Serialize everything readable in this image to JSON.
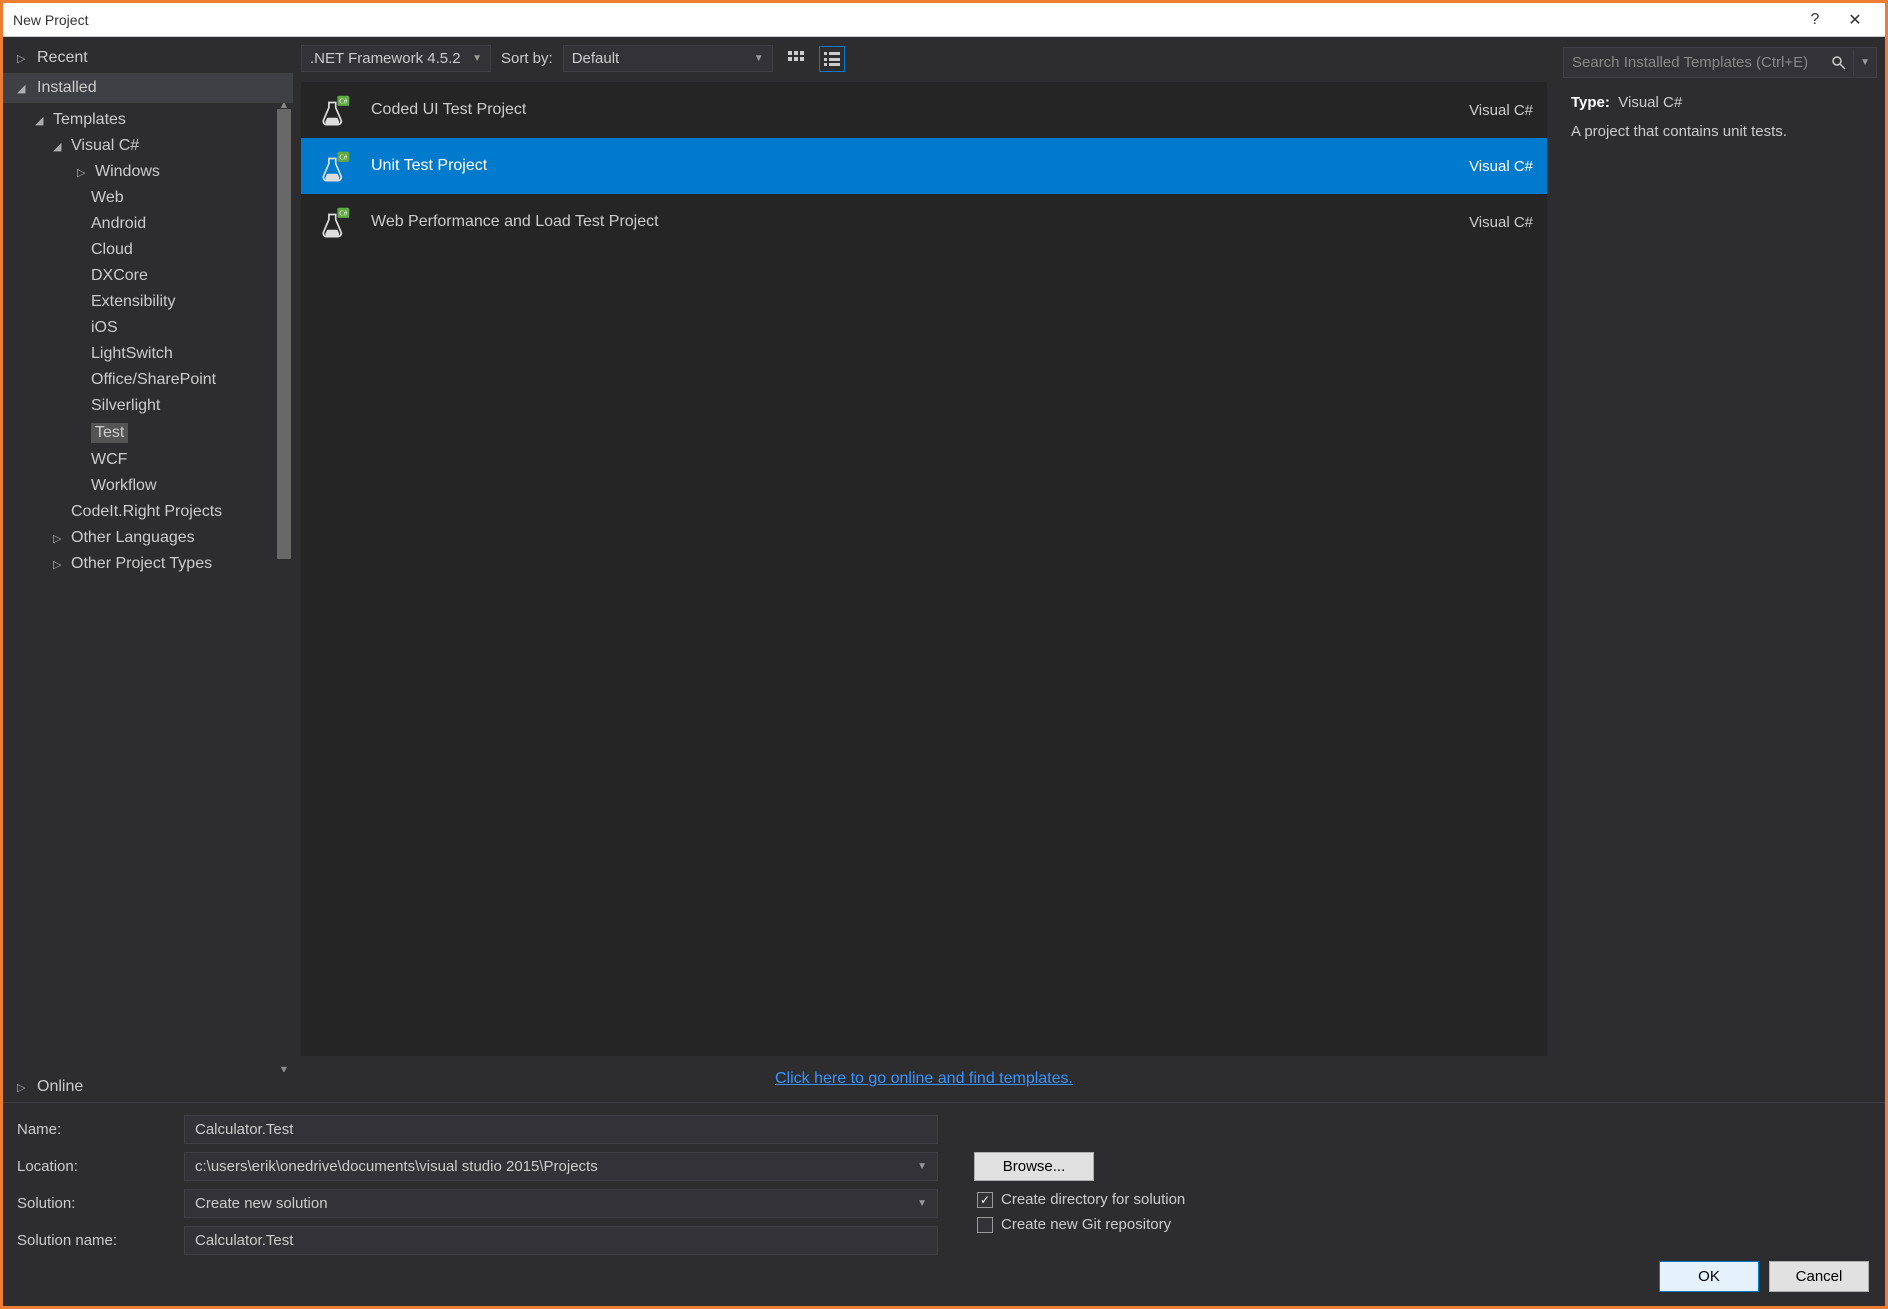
{
  "window": {
    "title": "New Project"
  },
  "sidebar": {
    "recent": "Recent",
    "installed": "Installed",
    "online": "Online",
    "templates": "Templates",
    "root_lang": "Visual C#",
    "categories": [
      {
        "label": "Windows",
        "expandable": true
      },
      {
        "label": "Web"
      },
      {
        "label": "Android"
      },
      {
        "label": "Cloud"
      },
      {
        "label": "DXCore"
      },
      {
        "label": "Extensibility"
      },
      {
        "label": "iOS"
      },
      {
        "label": "LightSwitch"
      },
      {
        "label": "Office/SharePoint"
      },
      {
        "label": "Silverlight"
      },
      {
        "label": "Test",
        "selected": true
      },
      {
        "label": "WCF"
      },
      {
        "label": "Workflow"
      }
    ],
    "extra": [
      {
        "label": "CodeIt.Right Projects",
        "expandable": false
      },
      {
        "label": "Other Languages",
        "expandable": true
      },
      {
        "label": "Other Project Types",
        "expandable": true
      }
    ]
  },
  "toolbar": {
    "framework": ".NET Framework 4.5.2",
    "sort_by_label": "Sort by:",
    "sort_value": "Default"
  },
  "templates": [
    {
      "name": "Coded UI Test Project",
      "lang": "Visual C#"
    },
    {
      "name": "Unit Test Project",
      "lang": "Visual C#",
      "selected": true
    },
    {
      "name": "Web Performance and Load Test Project",
      "lang": "Visual C#"
    }
  ],
  "online_link": "Click here to go online and find templates.",
  "search": {
    "placeholder": "Search Installed Templates (Ctrl+E)"
  },
  "details": {
    "type_label": "Type:",
    "type_value": "Visual C#",
    "description": "A project that contains unit tests."
  },
  "form": {
    "name_label": "Name:",
    "name_value": "Calculator.Test",
    "location_label": "Location:",
    "location_value": "c:\\users\\erik\\onedrive\\documents\\visual studio 2015\\Projects",
    "browse": "Browse...",
    "solution_label": "Solution:",
    "solution_value": "Create new solution",
    "solname_label": "Solution name:",
    "solname_value": "Calculator.Test",
    "check_createdir": "Create directory for solution",
    "check_git": "Create new Git repository",
    "ok": "OK",
    "cancel": "Cancel"
  }
}
